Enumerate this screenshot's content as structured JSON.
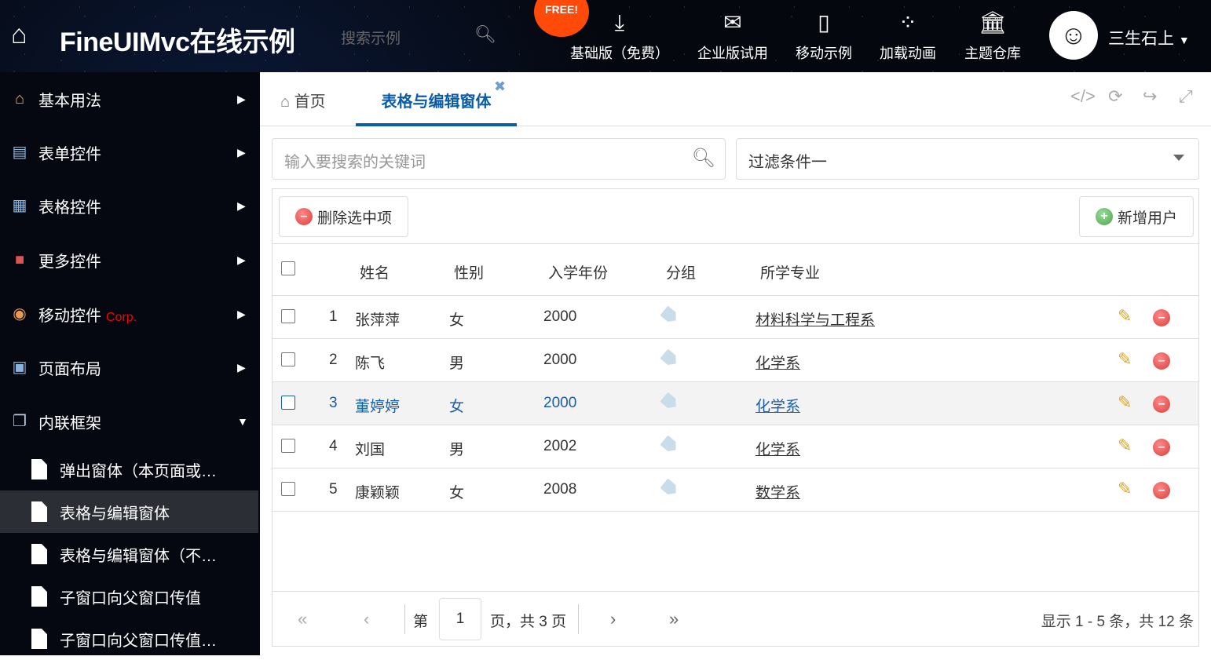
{
  "header": {
    "title": "FineUIMvc在线示例",
    "search_placeholder": "搜索示例",
    "free_badge": "FREE!",
    "nav": [
      {
        "label": "基础版（免费）",
        "icon": "download-icon"
      },
      {
        "label": "企业版试用",
        "icon": "envelope-icon"
      },
      {
        "label": "移动示例",
        "icon": "mobile-icon"
      },
      {
        "label": "加载动画",
        "icon": "spinner-icon"
      },
      {
        "label": "主题仓库",
        "icon": "bank-icon"
      }
    ],
    "user": "三生石上"
  },
  "sidebar": {
    "items": [
      {
        "label": "基本用法"
      },
      {
        "label": "表单控件"
      },
      {
        "label": "表格控件"
      },
      {
        "label": "更多控件"
      },
      {
        "label": "移动控件",
        "badge": "Corp."
      },
      {
        "label": "页面布局"
      },
      {
        "label": "内联框架"
      }
    ],
    "subitems": [
      {
        "label": "弹出窗体（本页面或…"
      },
      {
        "label": "表格与编辑窗体"
      },
      {
        "label": "表格与编辑窗体（不…"
      },
      {
        "label": "子窗口向父窗口传值"
      },
      {
        "label": "子窗口向父窗口传值…"
      }
    ]
  },
  "tabs": {
    "home": "首页",
    "active": "表格与编辑窗体"
  },
  "search": {
    "placeholder": "输入要搜索的关键词"
  },
  "filter": {
    "selected": "过滤条件一"
  },
  "toolbar": {
    "delete_label": "删除选中项",
    "add_label": "新增用户"
  },
  "grid": {
    "columns": [
      "姓名",
      "性别",
      "入学年份",
      "分组",
      "所学专业"
    ],
    "rows": [
      {
        "num": "1",
        "name": "张萍萍",
        "gender": "女",
        "year": "2000",
        "major": "材料科学与工程系"
      },
      {
        "num": "2",
        "name": "陈飞",
        "gender": "男",
        "year": "2000",
        "major": "化学系"
      },
      {
        "num": "3",
        "name": "董婷婷",
        "gender": "女",
        "year": "2000",
        "major": "化学系"
      },
      {
        "num": "4",
        "name": "刘国",
        "gender": "男",
        "year": "2002",
        "major": "化学系"
      },
      {
        "num": "5",
        "name": "康颖颖",
        "gender": "女",
        "year": "2008",
        "major": "数学系"
      }
    ]
  },
  "pager": {
    "prefix": "第",
    "page": "1",
    "suffix": "页，共 3 页",
    "summary": "显示 1 - 5 条，共 12 条"
  },
  "colors": {
    "accent": "#0b5ca8",
    "corp": "#ff0000"
  }
}
